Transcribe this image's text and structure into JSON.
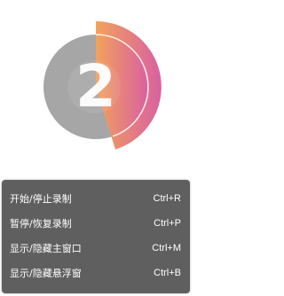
{
  "recorder_badge": {
    "countdown": "2",
    "icon": "countdown-ring-icon",
    "colors": {
      "disc": "#a6a6a6",
      "accent_start": "#f2a25c",
      "accent_end": "#d960a0",
      "number": "#ffffff"
    }
  },
  "context_menu": {
    "background": "#5f5f5f",
    "items": [
      {
        "label": "开始/停止录制",
        "shortcut": "Ctrl+R"
      },
      {
        "label": "暂停/恢复录制",
        "shortcut": "Ctrl+P"
      },
      {
        "label": "显示/隐藏主窗口",
        "shortcut": "Ctrl+M"
      },
      {
        "label": "显示/隐藏悬浮窗",
        "shortcut": "Ctrl+B"
      }
    ]
  }
}
